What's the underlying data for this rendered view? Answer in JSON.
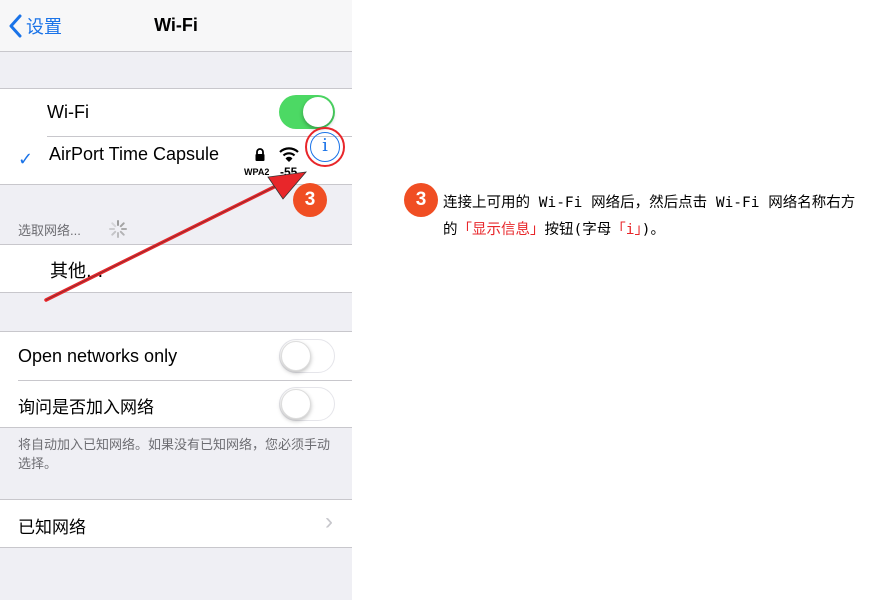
{
  "nav": {
    "back_label": "设置",
    "title": "Wi-Fi"
  },
  "wifi_row": {
    "label": "Wi-Fi",
    "toggle_on": true
  },
  "connected_network": {
    "check": "✓",
    "name": "AirPort Time Capsule",
    "lock_icon": "lock-icon",
    "signal_icon": "wifi-signal-icon",
    "security": "WPA2",
    "rssi": "-55",
    "info_glyph": "i"
  },
  "choose_network_header": "选取网络...",
  "other_row": {
    "label": "其他..."
  },
  "open_networks_row": {
    "label": "Open networks only",
    "toggle_on": false
  },
  "ask_join_row": {
    "label": "询问是否加入网络",
    "toggle_on": false
  },
  "ask_join_footer": "将自动加入已知网络。如果没有已知网络，您必须手动选择。",
  "known_networks_row": {
    "label": "已知网络",
    "chevron": "›"
  },
  "step_badge": "3",
  "annotation": {
    "badge": "3",
    "text_before": "连接上可用的 Wi-Fi 网络后，然后点击 Wi-Fi 网络名称右方的",
    "highlight_1": "「显示信息」",
    "text_middle": "按钮(字母",
    "highlight_2": "「i」",
    "text_after": ")。"
  },
  "colors": {
    "ios_blue": "#1a73e8",
    "toggle_green": "#4cd964",
    "annotation_red": "#e8262a",
    "badge_orange": "#f04e23",
    "grouped_background": "#efeff4"
  }
}
